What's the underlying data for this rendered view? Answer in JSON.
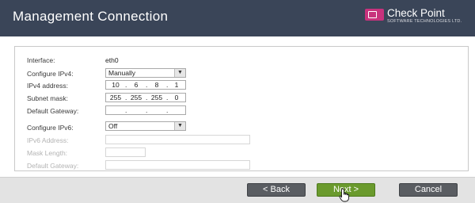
{
  "header": {
    "title": "Management Connection",
    "logo_name": "Check Point",
    "logo_sub": "SOFTWARE TECHNOLOGIES LTD."
  },
  "form": {
    "interface_label": "Interface:",
    "interface_value": "eth0",
    "configure_ipv4_label": "Configure IPv4:",
    "configure_ipv4_value": "Manually",
    "ipv4_address_label": "IPv4 address:",
    "ipv4_address": [
      "10",
      "6",
      "8",
      "1"
    ],
    "subnet_mask_label": "Subnet mask:",
    "subnet_mask": [
      "255",
      "255",
      "255",
      "0"
    ],
    "default_gateway_label": "Default Gateway:",
    "default_gateway": [
      "",
      "",
      "",
      ""
    ],
    "configure_ipv6_label": "Configure IPv6:",
    "configure_ipv6_value": "Off",
    "ipv6_address_label": "IPv6 Address:",
    "mask_length_label": "Mask Length:",
    "ipv6_gateway_label": "Default Gateway:"
  },
  "buttons": {
    "back": "< Back",
    "next": "Next >",
    "cancel": "Cancel"
  },
  "colors": {
    "header_bg": "#3a4558",
    "logo_accent": "#c8327d",
    "next_green": "#6a9a2d",
    "button_gray": "#5a5d62"
  },
  "icons": [
    "chevron-down-icon",
    "hand-pointer-icon",
    "check-point-logo"
  ]
}
